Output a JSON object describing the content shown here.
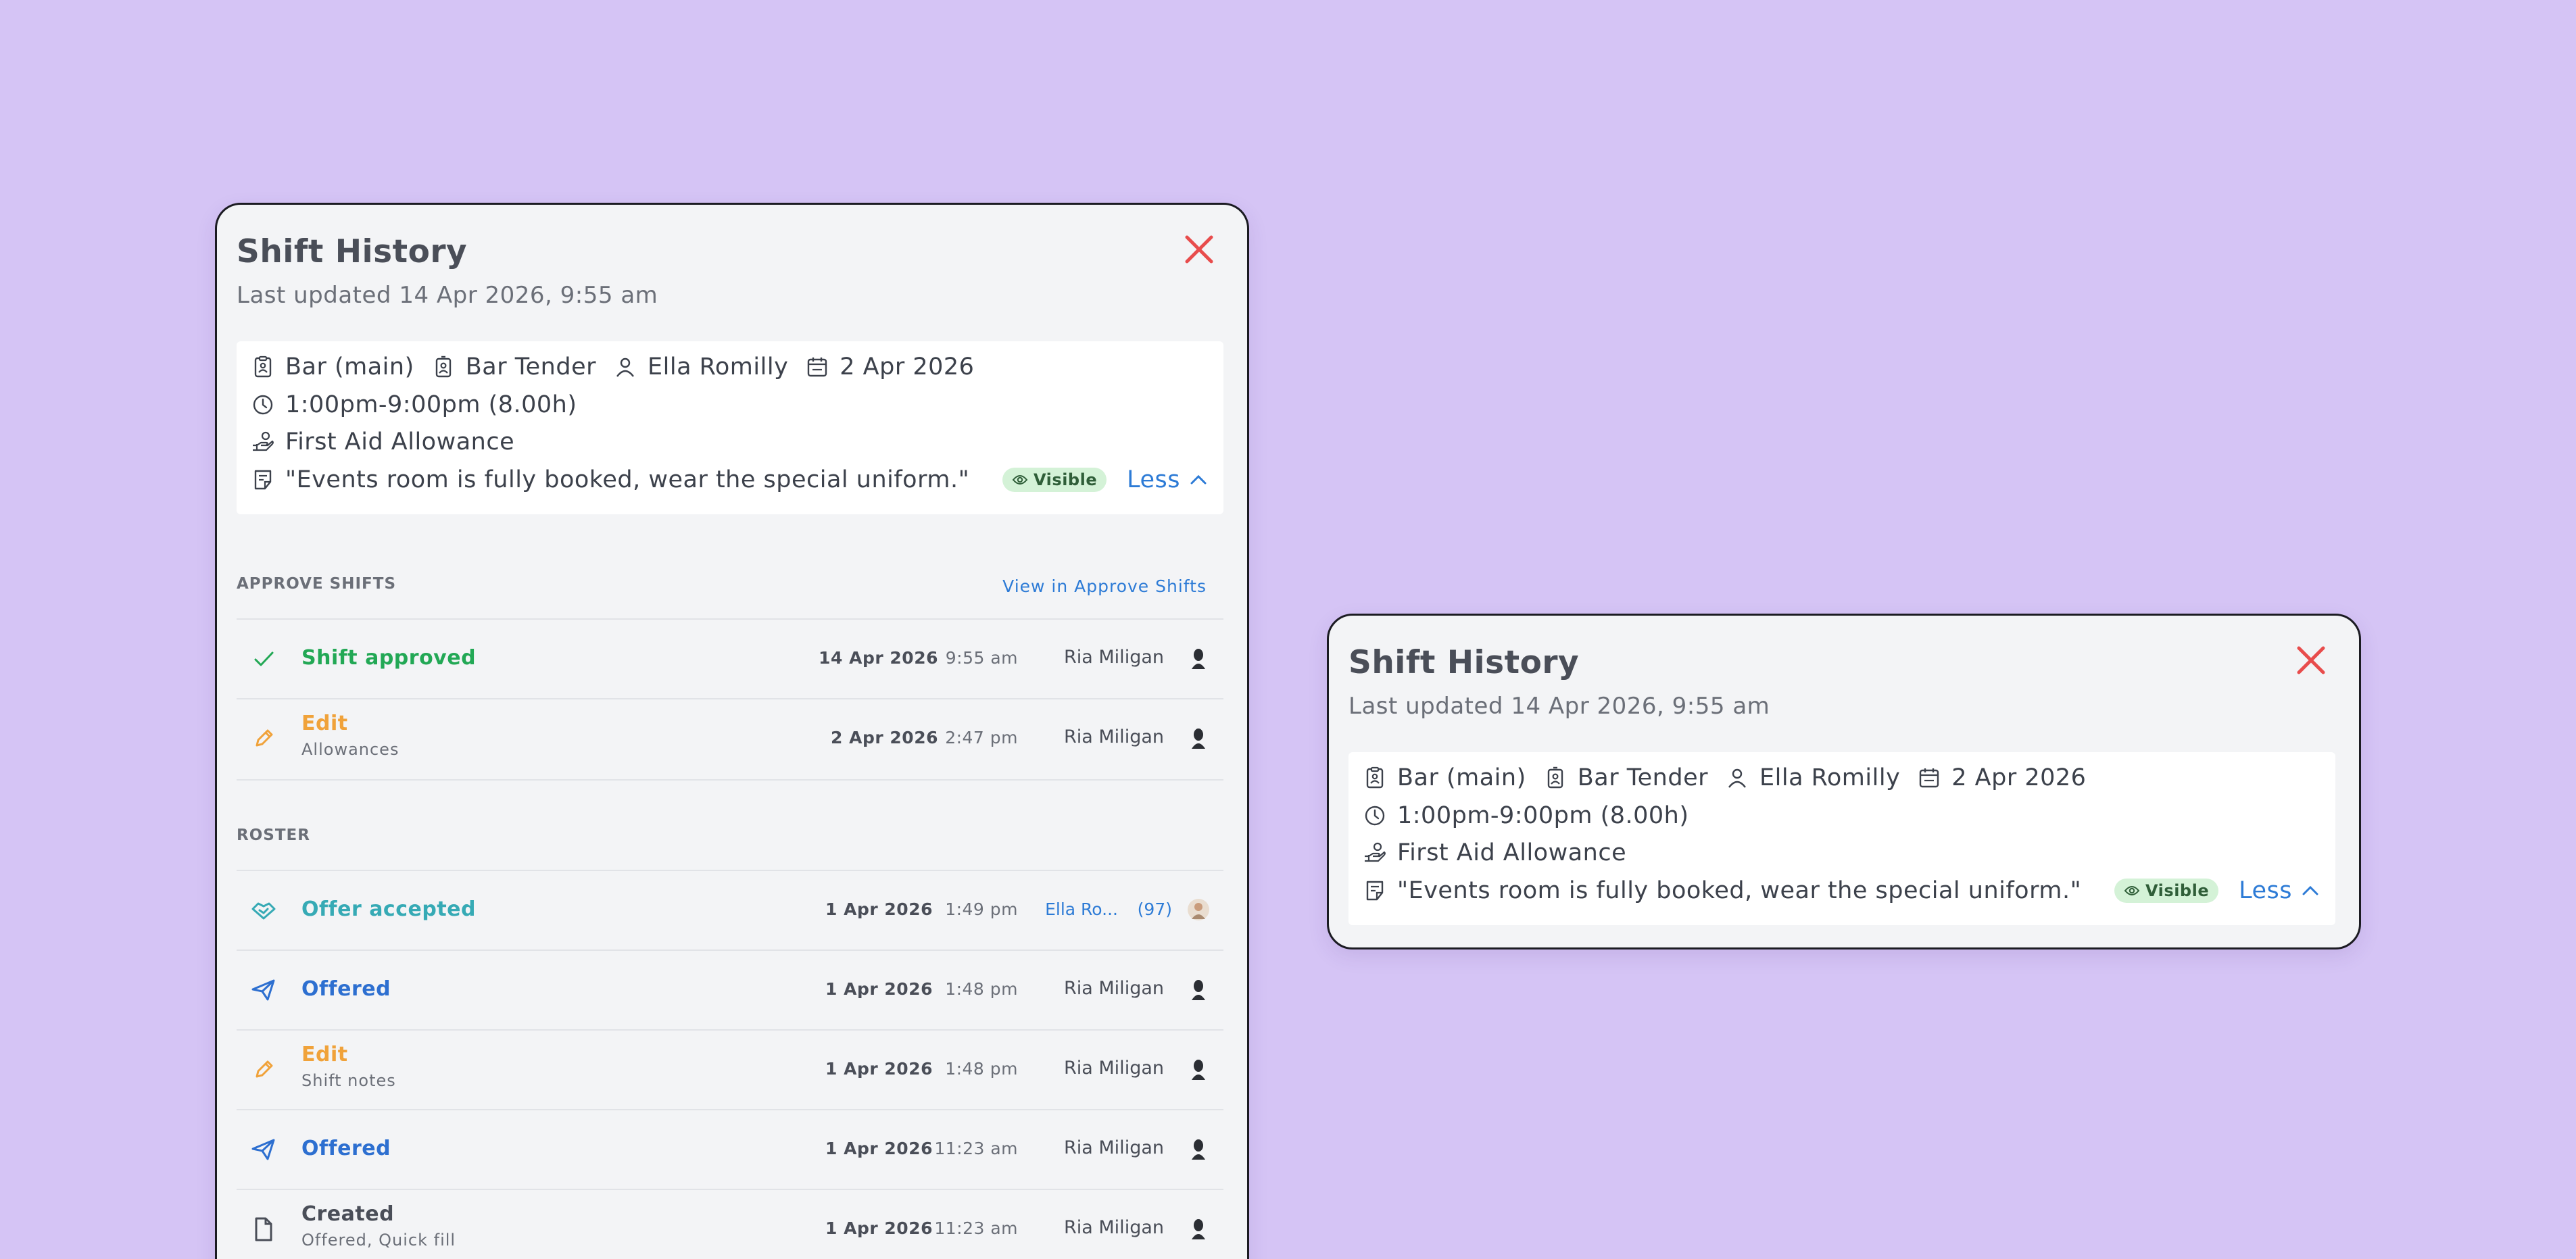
{
  "panel": {
    "title": "Shift History",
    "last_updated": "Last updated 14 Apr 2026, 9:55 am"
  },
  "summary": {
    "location": "Bar (main)",
    "role": "Bar Tender",
    "person": "Ella Romilly",
    "date": "2 Apr 2026",
    "time": "1:00pm-9:00pm (8.00h)",
    "allowance": "First Aid Allowance",
    "note": "\"Events room is fully booked, wear the special uniform.\"",
    "visibility_badge": "Visible",
    "less_label": "Less"
  },
  "approve_section": {
    "heading": "APPROVE SHIFTS",
    "link": "View in Approve Shifts",
    "rows": [
      {
        "label": "Shift approved",
        "sub": "",
        "date": "14 Apr 2026",
        "time": "9:55 am",
        "user": "Ria Miligan"
      },
      {
        "label": "Edit",
        "sub": "Allowances",
        "date": "2 Apr 2026",
        "time": "2:47 pm",
        "user": "Ria Miligan"
      }
    ]
  },
  "roster_section": {
    "heading": "ROSTER",
    "rows": [
      {
        "label": "Offer accepted",
        "sub": "",
        "date": "1 Apr 2026",
        "time": "1:49 pm",
        "user": "Ella Ro...",
        "count": "(97)"
      },
      {
        "label": "Offered",
        "sub": "",
        "date": "1 Apr 2026",
        "time": "1:48 pm",
        "user": "Ria Miligan"
      },
      {
        "label": "Edit",
        "sub": "Shift notes",
        "date": "1 Apr 2026",
        "time": "1:48 pm",
        "user": "Ria Miligan"
      },
      {
        "label": "Offered",
        "sub": "",
        "date": "1 Apr 2026",
        "time": "11:23 am",
        "user": "Ria Miligan"
      },
      {
        "label": "Created",
        "sub": "Offered, Quick fill",
        "date": "1 Apr 2026",
        "time": "11:23 am",
        "user": "Ria Miligan"
      }
    ]
  },
  "colors": {
    "background": "#d5c4f5",
    "close": "#e84c4c",
    "approved": "#22a855",
    "edit": "#f0a23a",
    "accepted": "#36aab5",
    "offered": "#2d6fd0",
    "link": "#2d7bd6",
    "badge_bg": "#d4f2d7"
  },
  "icons": {
    "close": "close-icon",
    "location": "location-badge-icon",
    "role": "id-badge-icon",
    "person": "person-icon",
    "calendar": "calendar-icon",
    "clock": "clock-icon",
    "allowance": "hand-coin-icon",
    "note": "note-icon",
    "eye": "eye-icon",
    "chevron_up": "chevron-up-icon"
  }
}
